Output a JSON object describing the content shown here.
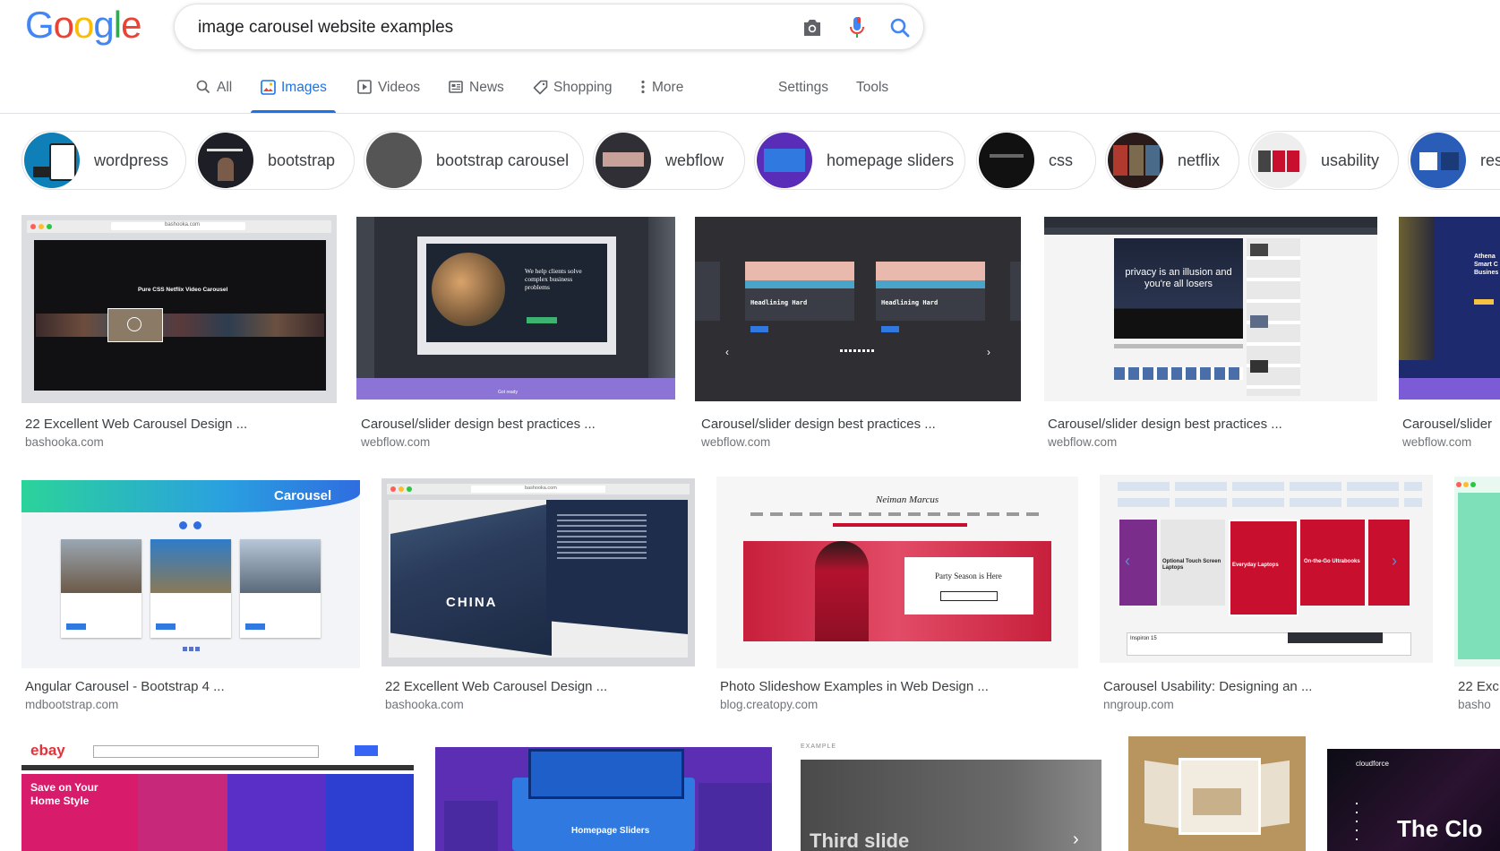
{
  "logo": {
    "letters": [
      "G",
      "o",
      "o",
      "g",
      "l",
      "e"
    ],
    "colors": [
      "#4285F4",
      "#EA4335",
      "#FBBC05",
      "#4285F4",
      "#34A853",
      "#EA4335"
    ]
  },
  "search": {
    "query": "image carousel website examples"
  },
  "tabs": [
    {
      "label": "All",
      "icon": "search-icon"
    },
    {
      "label": "Images",
      "icon": "image-icon",
      "active": true
    },
    {
      "label": "Videos",
      "icon": "play-icon"
    },
    {
      "label": "News",
      "icon": "news-icon"
    },
    {
      "label": "Shopping",
      "icon": "tag-icon"
    },
    {
      "label": "More",
      "icon": "more-vertical-icon"
    },
    {
      "label": "Settings"
    },
    {
      "label": "Tools"
    }
  ],
  "chips": [
    "wordpress",
    "bootstrap",
    "bootstrap carousel",
    "webflow",
    "homepage sliders",
    "css",
    "netflix",
    "usability",
    "res"
  ],
  "results": {
    "row1": [
      {
        "title": "22 Excellent Web Carousel Design ...",
        "source": "bashooka.com",
        "thumb_text": [
          "bashooka.com",
          "Pure CSS Netflix Video Carousel"
        ]
      },
      {
        "title": "Carousel/slider design best practices ...",
        "source": "webflow.com",
        "thumb_text": [
          "We help clients solve complex business problems",
          "Got ready"
        ]
      },
      {
        "title": "Carousel/slider design best practices ...",
        "source": "webflow.com",
        "thumb_text": [
          "Headlining Hard",
          "Headlining Hard"
        ]
      },
      {
        "title": "Carousel/slider design best practices ...",
        "source": "webflow.com",
        "thumb_text": [
          "privacy is an illusion and you're all losers"
        ]
      },
      {
        "title": "Carousel/slider",
        "source": "webflow.com",
        "thumb_text": [
          "Athena Smart C Busines"
        ]
      }
    ],
    "row2": [
      {
        "title": "Angular Carousel - Bootstrap 4 ...",
        "source": "mdbootstrap.com",
        "thumb_text": [
          "Carousel"
        ]
      },
      {
        "title": "22 Excellent Web Carousel Design ...",
        "source": "bashooka.com",
        "thumb_text": [
          "CHINA",
          "bashooka.com"
        ]
      },
      {
        "title": "Photo Slideshow Examples in Web Design ...",
        "source": "blog.creatopy.com",
        "thumb_text": [
          "Neiman Marcus",
          "Party Season is Here"
        ]
      },
      {
        "title": "Carousel Usability: Designing an ...",
        "source": "nngroup.com",
        "thumb_text": [
          "Optional Touch Screen Laptops",
          "Everyday Laptops",
          "On-the-Go Ultrabooks",
          "Inspiron 15"
        ]
      },
      {
        "title": "22 Exc",
        "source": "basho",
        "thumb_text": []
      }
    ],
    "row3": [
      {
        "thumb_text": [
          "ebay",
          "Save on Your Home Style"
        ]
      },
      {
        "thumb_text": [
          "Homepage Sliders"
        ]
      },
      {
        "thumb_text": [
          "EXAMPLE",
          "Third slide"
        ]
      },
      {
        "thumb_text": []
      },
      {
        "thumb_text": [
          "cloudforce",
          "The Clo"
        ]
      }
    ]
  },
  "colors": {
    "accent": "#1a73e8",
    "muted": "#5f6368",
    "border": "#dfe1e5"
  }
}
